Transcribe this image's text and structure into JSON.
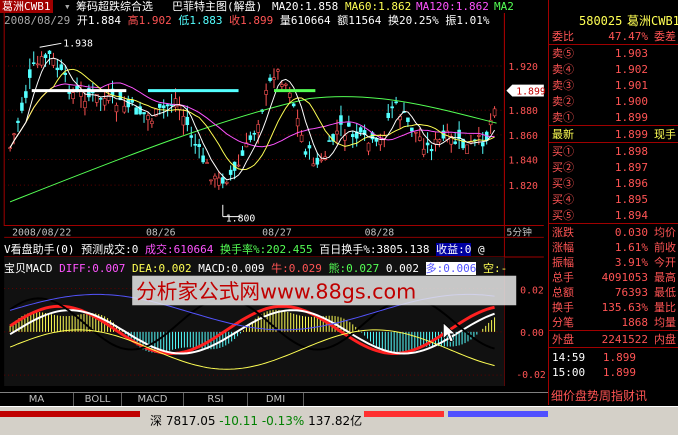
{
  "header": {
    "stock_name": "葛洲CWB1",
    "indicator": "筹码超跌综合选",
    "template": "巴菲特主图(解盘)",
    "ma20": "MA20:1.858",
    "ma60": "MA60:1.862",
    "ma120": "MA120:1.862",
    "ma_extra": "MA2",
    "date_label": "2008/08/29",
    "open": "开1.884",
    "high": "高1.902",
    "low": "低1.883",
    "close": "收1.899",
    "volume": "量610664",
    "amount": "额11564",
    "turnover": "换20.25%",
    "amplitude": "振1.01%"
  },
  "main_chart": {
    "high_label": "1.938",
    "low_label": "1.800",
    "price_ticks": [
      "1.920",
      "1.880",
      "1.860",
      "1.840",
      "1.820"
    ],
    "current_price": "1.899",
    "date_ticks": [
      "2008/08/22",
      "08/26",
      "08/27",
      "08/28"
    ],
    "period": "5分钟"
  },
  "sub1": {
    "title": "V看盘助手(0)",
    "forecast": "预测成交:0",
    "deal": "成交:610664",
    "turnover_rate": "换手率%:202.455",
    "hundred_day": "百日换手%:3805.138",
    "profit": "收益:0",
    "extra": "@"
  },
  "sub2": {
    "title": "宝贝MACD",
    "diff": "DIFF:0.007",
    "dea": "DEA:0.002",
    "macd": "MACD:0.009",
    "niu": "牛:0.029",
    "neng": "熊:0.027",
    "val": "0.002",
    "duo": "多:0.006",
    "kong": "空:-",
    "ticks": [
      "0.02",
      "0.00",
      "-0.02"
    ],
    "watermark": "分析家公式网www.88gs.com"
  },
  "tabs": [
    "MA",
    "BOLL",
    "MACD",
    "RSI",
    "DMI"
  ],
  "panel": {
    "code": "580025",
    "name": "葛洲CWB1",
    "webi_label": "委比",
    "webi_val": "47.47%",
    "weicha_label": "委差",
    "sells": [
      {
        "label": "卖⑤",
        "price": "1.903"
      },
      {
        "label": "卖④",
        "price": "1.902"
      },
      {
        "label": "卖③",
        "price": "1.901"
      },
      {
        "label": "卖②",
        "price": "1.900"
      },
      {
        "label": "卖①",
        "price": "1.899"
      }
    ],
    "latest_label": "最新",
    "latest_val": "1.899",
    "latest_ext": "现手",
    "buys": [
      {
        "label": "买①",
        "price": "1.898"
      },
      {
        "label": "买②",
        "price": "1.897"
      },
      {
        "label": "买③",
        "price": "1.896"
      },
      {
        "label": "买④",
        "price": "1.895"
      },
      {
        "label": "买⑤",
        "price": "1.894"
      }
    ],
    "stats": [
      {
        "label": "涨跌",
        "val": "0.030",
        "ext": "均价"
      },
      {
        "label": "涨幅",
        "val": "1.61%",
        "ext": "前收"
      },
      {
        "label": "振幅",
        "val": "3.91%",
        "ext": "今开"
      },
      {
        "label": "总手",
        "val": "4091053",
        "ext": "最高"
      },
      {
        "label": "总额",
        "val": "76393",
        "ext": "最低"
      },
      {
        "label": "换手",
        "val": "135.63%",
        "ext": "量比"
      },
      {
        "label": "分笔",
        "val": "1868",
        "ext": "均量"
      }
    ],
    "outer_label": "外盘",
    "outer_val": "2241522",
    "inner_label": "内盘",
    "ticks": [
      {
        "time": "14:59",
        "price": "1.899"
      },
      {
        "time": "15:00",
        "price": "1.899"
      }
    ],
    "bottom_tabs": "细价盘势周指财讯"
  },
  "status_bar": {
    "index_name": "深",
    "index_value": "7817.05",
    "change": "-10.11",
    "pct": "-0.13%",
    "amount": "137.82亿"
  },
  "colors": {
    "up": "#ff5454",
    "down": "#54ffff",
    "ma5": "#ffffff",
    "ma10": "#ffff54",
    "ma20": "#ff54ff",
    "ma60": "#54ff54"
  }
}
